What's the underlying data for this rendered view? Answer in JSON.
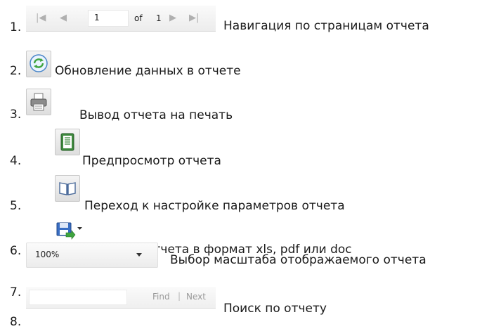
{
  "items": [
    {
      "number": "1.",
      "description": "Навигация по страницам отчета"
    },
    {
      "number": "2.",
      "description": "Обновление данных в отчете"
    },
    {
      "number": "3.",
      "description": "Вывод отчета на печать"
    },
    {
      "number": "4.",
      "description": "Предпросмотр отчета"
    },
    {
      "number": "5.",
      "description": "Переход к настройке параметров отчета"
    },
    {
      "number": "6.",
      "description": "Экспорт отчета в формат xls, pdf или doc"
    },
    {
      "number": "7.",
      "description": "Выбор масштаба отображаемого отчета"
    },
    {
      "number": "8.",
      "description": "Поиск по отчету"
    }
  ],
  "pager": {
    "page": "1",
    "of_label": "of",
    "total": "1"
  },
  "zoom": {
    "value": "100%"
  },
  "find": {
    "find_label": "Find",
    "separator": "|",
    "next_label": "Next"
  },
  "icons": {
    "first_page": "first-page-icon",
    "prev_page": "prev-page-icon",
    "next_page": "next-page-icon",
    "last_page": "last-page-icon",
    "refresh": "refresh-icon",
    "print": "print-icon",
    "preview": "print-preview-icon",
    "parameters": "open-book-icon",
    "export": "save-export-icon"
  },
  "colors": {
    "accent_green": "#3fa43f",
    "accent_blue": "#3a6fc4"
  }
}
